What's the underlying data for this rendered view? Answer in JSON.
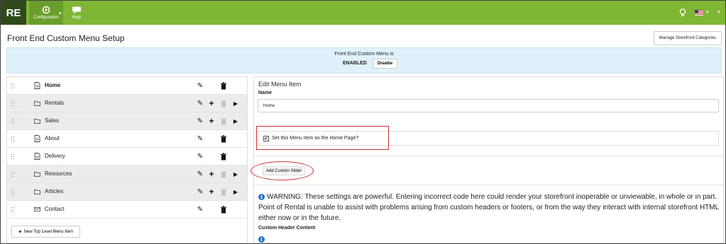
{
  "app": {
    "logo": "RE",
    "nav": [
      {
        "label": "Configuration",
        "icon": "gear-icon"
      },
      {
        "label": "Help",
        "icon": "chat-bubble-icon"
      }
    ]
  },
  "header": {
    "title": "Front End Custom Menu Setup",
    "manage_button": "Manage Storefront Categories"
  },
  "banner": {
    "title": "Front End Custom Menu is",
    "status": "ENABLED",
    "disable_button": "Disable"
  },
  "menu": {
    "items": [
      {
        "label": "Home",
        "icon": "document-icon",
        "type": "page",
        "bold": true
      },
      {
        "label": "Rentals",
        "icon": "folder-icon",
        "type": "folder"
      },
      {
        "label": "Sales",
        "icon": "folder-icon",
        "type": "folder"
      },
      {
        "label": "About",
        "icon": "document-icon",
        "type": "page"
      },
      {
        "label": "Delivery",
        "icon": "document-icon",
        "type": "page"
      },
      {
        "label": "Resources",
        "icon": "folder-icon",
        "type": "folder"
      },
      {
        "label": "Articles",
        "icon": "folder-icon",
        "type": "folder"
      },
      {
        "label": "Contact",
        "icon": "envelope-icon",
        "type": "page"
      }
    ],
    "new_top_level_button": "New Top Level Menu Item"
  },
  "editor": {
    "title": "Edit Menu Item",
    "name_label": "Name",
    "name_value": "Home",
    "home_checkbox_label": "Set this Menu Item as the Home Page?",
    "home_checked": true,
    "add_slider_button": "Add Custom Slider",
    "warning_text": "WARNING: These settings are powerful. Entering incorrect code here could render your storefront inoperable or unviewable, in whole or in part. Point of Rental is unable to assist with problems arising from custom headers or footers, or from the way they interact with internal storefront HTML either now or in the future.",
    "custom_header_label": "Custom Header Content"
  },
  "colors": {
    "topbar": "#7fb735",
    "logo_bg": "#2f4a1a",
    "banner_bg": "#dff2fb",
    "annotation_red": "#d32f2f",
    "info_blue": "#2a72c4"
  }
}
